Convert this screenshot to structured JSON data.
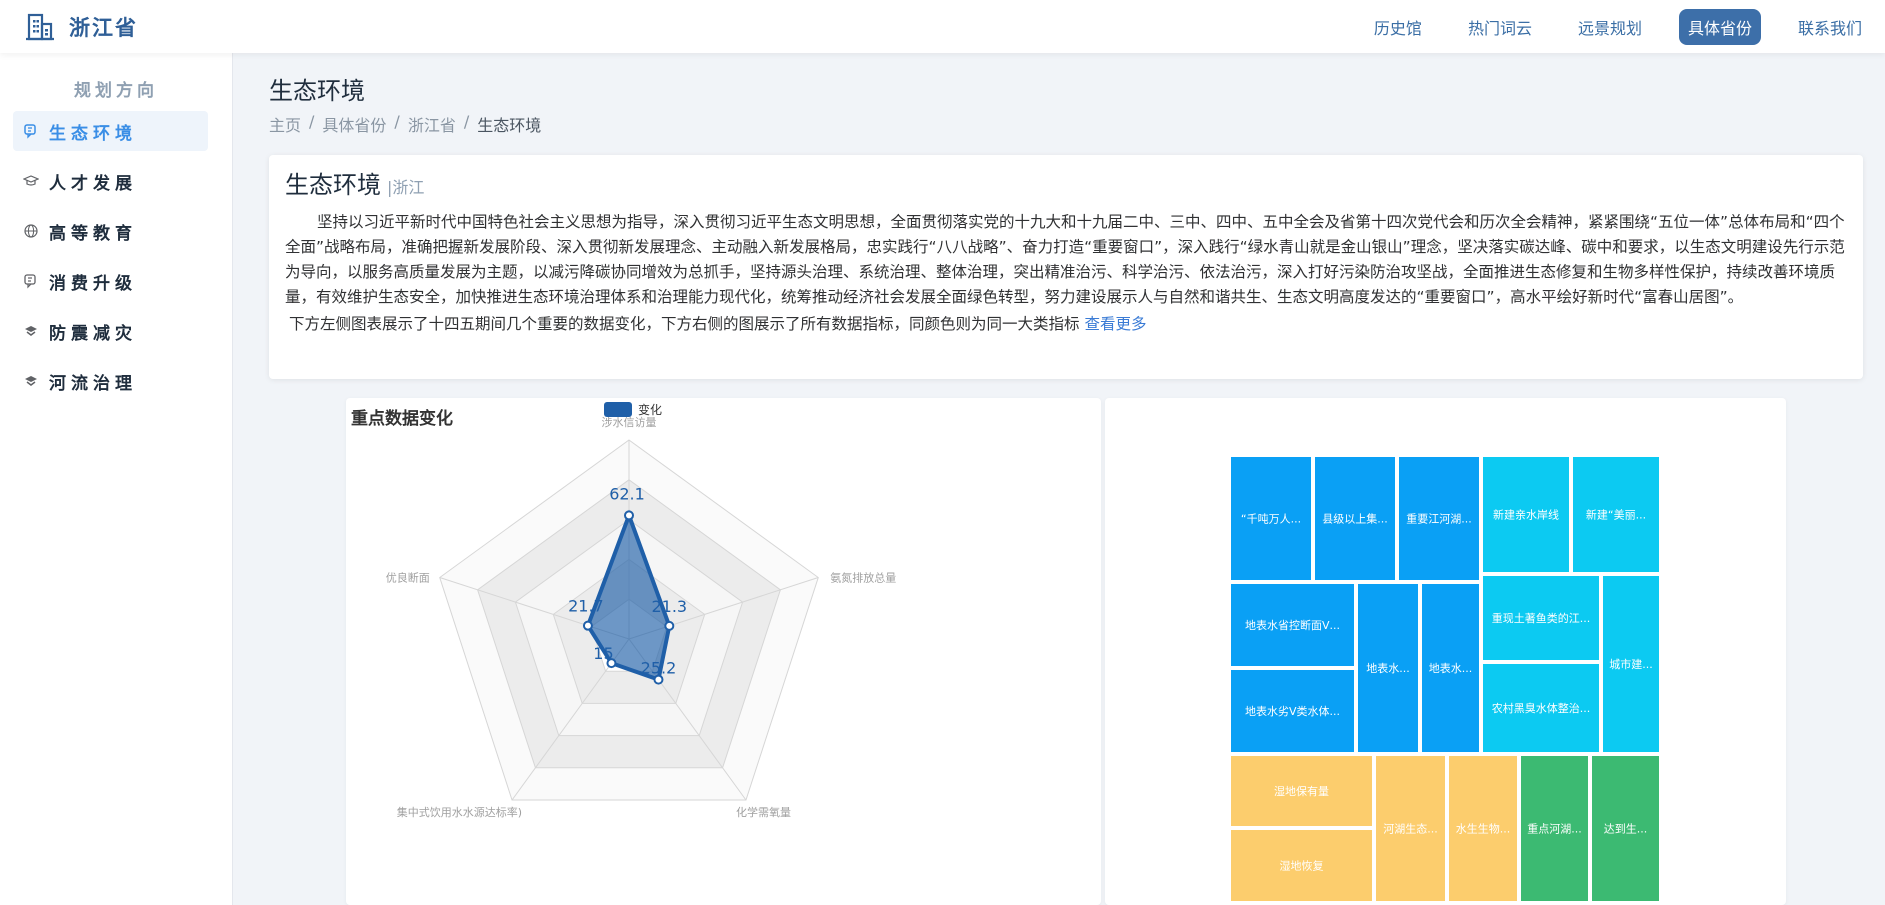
{
  "header": {
    "title": "浙江省",
    "nav": [
      {
        "label": "历史馆",
        "active": false
      },
      {
        "label": "热门词云",
        "active": false
      },
      {
        "label": "远景规划",
        "active": false
      },
      {
        "label": "具体省份",
        "active": true
      },
      {
        "label": "联系我们",
        "active": false
      }
    ]
  },
  "sidebar": {
    "heading": "规划方向",
    "items": [
      {
        "label": "生态环境",
        "icon": "leaf-icon",
        "active": true
      },
      {
        "label": "人才发展",
        "icon": "graduation-cap-icon",
        "active": false
      },
      {
        "label": "高等教育",
        "icon": "globe-icon",
        "active": false
      },
      {
        "label": "消费升级",
        "icon": "chat-icon",
        "active": false
      },
      {
        "label": "防震减灾",
        "icon": "shield-icon",
        "active": false
      },
      {
        "label": "河流治理",
        "icon": "shield-icon",
        "active": false
      }
    ]
  },
  "main": {
    "page_title": "生态环境",
    "breadcrumb": [
      "主页",
      "具体省份",
      "浙江省",
      "生态环境"
    ],
    "intro": {
      "title": "生态环境",
      "tag": "|浙江",
      "text": "坚持以习近平新时代中国特色社会主义思想为指导，深入贯彻习近平生态文明思想，全面贯彻落实党的十九大和十九届二中、三中、四中、五中全会及省第十四次党代会和历次全会精神，紧紧围绕“五位一体”总体布局和“四个全面”战略布局，准确把握新发展阶段、深入贯彻新发展理念、主动融入新发展格局，忠实践行“八八战略”、奋力打造“重要窗口”，深入践行“绿水青山就是金山银山”理念，坚决落实碳达峰、碳中和要求，以生态文明建设先行示范为导向，以服务高质量发展为主题，以减污降碳协同增效为总抓手，坚持源头治理、系统治理、整体治理，突出精准治污、科学治污、依法治污，深入打好污染防治攻坚战，全面推进生态修复和生物多样性保护，持续改善环境质量，有效维护生态安全，加快推进生态环境治理体系和治理能力现代化，统筹推动经济社会发展全面绿色转型，努力建设展示人与自然和谐共生、生态文明高度发达的“重要窗口”，高水平绘好新时代“富春山居图”。",
      "note": "下方左侧图表展示了十四五期间几个重要的数据变化，下方右侧的图展示了所有数据指标，同颜色则为同一大类指标",
      "more_link": "查看更多"
    }
  },
  "chart_data": [
    {
      "type": "radar",
      "title": "重点数据变化",
      "legend": [
        "变化"
      ],
      "indicators": [
        "涉水信访量",
        "氨氮排放总量",
        "化学需氧量",
        "集中式饮用水水源达标率)",
        "优良断面"
      ],
      "series": [
        {
          "name": "变化",
          "values": [
            62.1,
            21.3,
            25.2,
            15,
            21.7
          ]
        }
      ],
      "max": 100,
      "color": "#1f5fa8"
    },
    {
      "type": "treemap",
      "groups": [
        {
          "color": "#0aa0f5",
          "items": [
            "“千吨万人...",
            "县级以上集...",
            "重要江河湖...",
            "地表水省控断面Ⅴ...",
            "地表水劣Ⅴ类水体...",
            "地表水...",
            "地表水..."
          ]
        },
        {
          "color": "#0ccaf2",
          "items": [
            "新建亲水岸线",
            "新建“美丽...",
            "重现土著鱼类的江...",
            "农村黑臭水体整治...",
            "城市建..."
          ]
        },
        {
          "color": "#fccd6d",
          "items": [
            "湿地保有量",
            "湿地恢复",
            "河湖生态...",
            "水生生物..."
          ]
        },
        {
          "color": "#3cba72",
          "items": [
            "重点河湖...",
            "达到生..."
          ]
        }
      ]
    }
  ]
}
